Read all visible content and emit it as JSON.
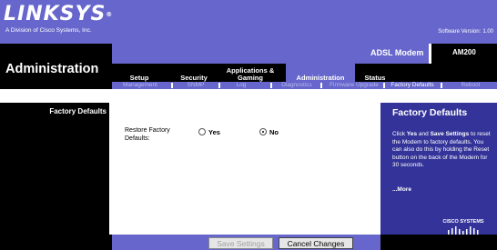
{
  "header": {
    "logo": "LINKSYS",
    "logo_mark": "®",
    "logo_subtitle": "A Division of Cisco Systems, Inc.",
    "software_version_label": "Software Version:",
    "software_version": "1.00"
  },
  "product": {
    "name": "ADSL Modem",
    "model": "AM200"
  },
  "section_title": "Administration",
  "tabs": [
    {
      "label": "Setup"
    },
    {
      "label": "Security"
    },
    {
      "label": "Applications & Gaming"
    },
    {
      "label": "Administration"
    },
    {
      "label": "Status"
    }
  ],
  "subtabs": [
    {
      "label": "Management"
    },
    {
      "label": "SNMP"
    },
    {
      "label": "Log"
    },
    {
      "label": "Diagnostics"
    },
    {
      "label": "Firmware Upgrade"
    },
    {
      "label": "Factory Defaults"
    },
    {
      "label": "Reboot"
    }
  ],
  "left_label": "Factory Defaults",
  "form": {
    "restore_label": "Restore Factory Defaults:",
    "option_yes": "Yes",
    "option_no": "No",
    "selected": "No"
  },
  "help": {
    "title": "Factory Defaults",
    "text_1": "Click ",
    "yes": "Yes",
    "text_2": " and ",
    "save": "Save Settings",
    "text_3": " to reset the Modem to factory defaults. You can also do this by holding the Reset button on the back of the Modem for 30 seconds.",
    "more": "...More"
  },
  "brand_footer": "CISCO SYSTEMS",
  "buttons": {
    "save": "Save Settings",
    "cancel": "Cancel Changes"
  },
  "colors": {
    "accent": "#6666cc",
    "help_panel": "#333399",
    "background_dark": "#000000"
  }
}
